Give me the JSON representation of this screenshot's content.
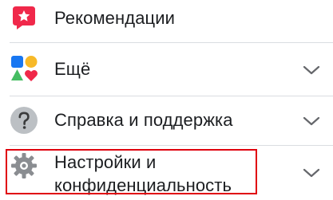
{
  "menu": {
    "items": [
      {
        "label": "Рекомендации",
        "icon": "recommendations-icon",
        "has_chevron": false
      },
      {
        "label": "Ещё",
        "icon": "more-apps-icon",
        "has_chevron": true
      },
      {
        "label": "Справка и поддержка",
        "icon": "help-icon",
        "has_chevron": true
      },
      {
        "label_line1": "Настройки и",
        "label_line2": "конфиденциальность",
        "icon": "gear-icon",
        "has_chevron": true
      }
    ]
  },
  "colors": {
    "highlight_border": "#e0000d",
    "recommendations_icon_bg": "#f0284a",
    "help_icon_bg": "#bcc0c4",
    "gear_icon": "#8a8d91",
    "chevron": "#65676b"
  }
}
